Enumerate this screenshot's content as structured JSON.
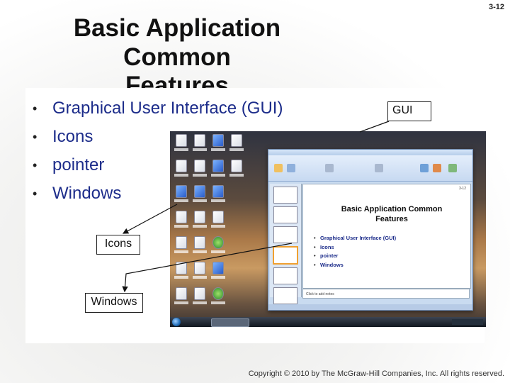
{
  "slide_number": "3-12",
  "title_lines": [
    "Basic Application Common",
    "Features"
  ],
  "bullets": [
    "Graphical User Interface (GUI)",
    "Icons",
    "pointer",
    "Windows"
  ],
  "callouts": {
    "gui": "GUI",
    "icons": "Icons",
    "windows": "Windows"
  },
  "screenshot": {
    "slide_number": "3-12",
    "title_lines": [
      "Basic Application Common",
      "Features"
    ],
    "bullets": [
      "Graphical User Interface (GUI)",
      "Icons",
      "pointer",
      "Windows"
    ],
    "notes": "Click to add notes"
  },
  "copyright": "Copyright © 2010 by The McGraw-Hill Companies, Inc. All rights reserved.",
  "colors": {
    "bullet_text": "#1c2c8a",
    "title": "#111111"
  }
}
